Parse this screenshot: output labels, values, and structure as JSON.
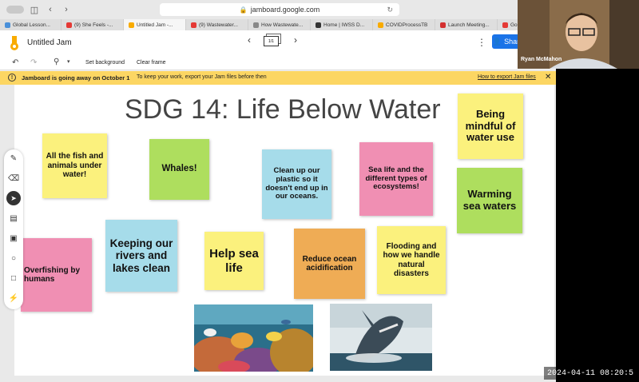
{
  "browser": {
    "url": "jamboard.google.com",
    "tabs": [
      {
        "label": "Global Lesson...",
        "color": "#4a90d9",
        "active": false
      },
      {
        "label": "(9) She Feels -...",
        "color": "#e53935",
        "active": false
      },
      {
        "label": "Untitled Jam -...",
        "color": "#f9ab00",
        "active": true
      },
      {
        "label": "(9) Wastewater...",
        "color": "#e53935",
        "active": false
      },
      {
        "label": "How Wastewate...",
        "color": "#888888",
        "active": false
      },
      {
        "label": "Home | IWSS D...",
        "color": "#333333",
        "active": false
      },
      {
        "label": "COVIDProcessTB",
        "color": "#f9ab00",
        "active": false
      },
      {
        "label": "Launch Meeting...",
        "color": "#d32f2f",
        "active": false
      },
      {
        "label": "Go...",
        "color": "#e53935",
        "active": false
      }
    ]
  },
  "app": {
    "title": "Untitled Jam",
    "frame_counter": "1/1",
    "share_label": "Share"
  },
  "toolbar": {
    "set_background": "Set background",
    "clear_frame": "Clear frame"
  },
  "banner": {
    "message": "Jamboard is going away on October 1",
    "sub": "To keep your work, export your Jam files before then",
    "link": "How to export Jam files"
  },
  "board": {
    "title": "SDG 14: Life Below Water",
    "notes": [
      {
        "id": "n1",
        "text": "All the fish and animals under water!"
      },
      {
        "id": "n2",
        "text": "Whales!"
      },
      {
        "id": "n3",
        "text": "Clean up our plastic so it doesn't end up in our oceans."
      },
      {
        "id": "n4",
        "text": "Sea life and the different types of ecosystems!"
      },
      {
        "id": "n5",
        "text": "Being mindful of water use"
      },
      {
        "id": "n6",
        "text": "Warming sea waters"
      },
      {
        "id": "n7",
        "text": "Overfishing by humans"
      },
      {
        "id": "n8",
        "text": "Keeping our rivers and lakes clean"
      },
      {
        "id": "n9",
        "text": "Help sea life"
      },
      {
        "id": "n10",
        "text": "Reduce ocean acidification"
      },
      {
        "id": "n11",
        "text": "Flooding and how we handle natural disasters"
      }
    ]
  },
  "webcam": {
    "name": "Ryan McMahon"
  },
  "overlay": {
    "timestamp": "2024-04-11 08:20:5"
  }
}
